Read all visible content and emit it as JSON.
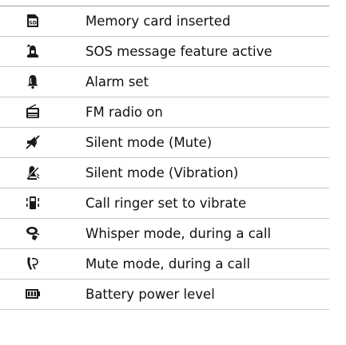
{
  "rows": [
    {
      "icon": "memory-card-icon",
      "text": "Memory card inserted"
    },
    {
      "icon": "sos-message-icon",
      "text": "SOS message feature active"
    },
    {
      "icon": "alarm-icon",
      "text": "Alarm set"
    },
    {
      "icon": "fm-radio-icon",
      "text": "FM radio on"
    },
    {
      "icon": "silent-mute-icon",
      "text": "Silent mode (Mute)"
    },
    {
      "icon": "silent-vibration-icon",
      "text": "Silent mode (Vibration)"
    },
    {
      "icon": "vibrate-ringer-icon",
      "text": "Call ringer set to vibrate"
    },
    {
      "icon": "whisper-mode-icon",
      "text": "Whisper mode, during a call"
    },
    {
      "icon": "mute-call-icon",
      "text": "Mute mode, during a call"
    },
    {
      "icon": "battery-icon",
      "text": "Battery power level"
    }
  ]
}
